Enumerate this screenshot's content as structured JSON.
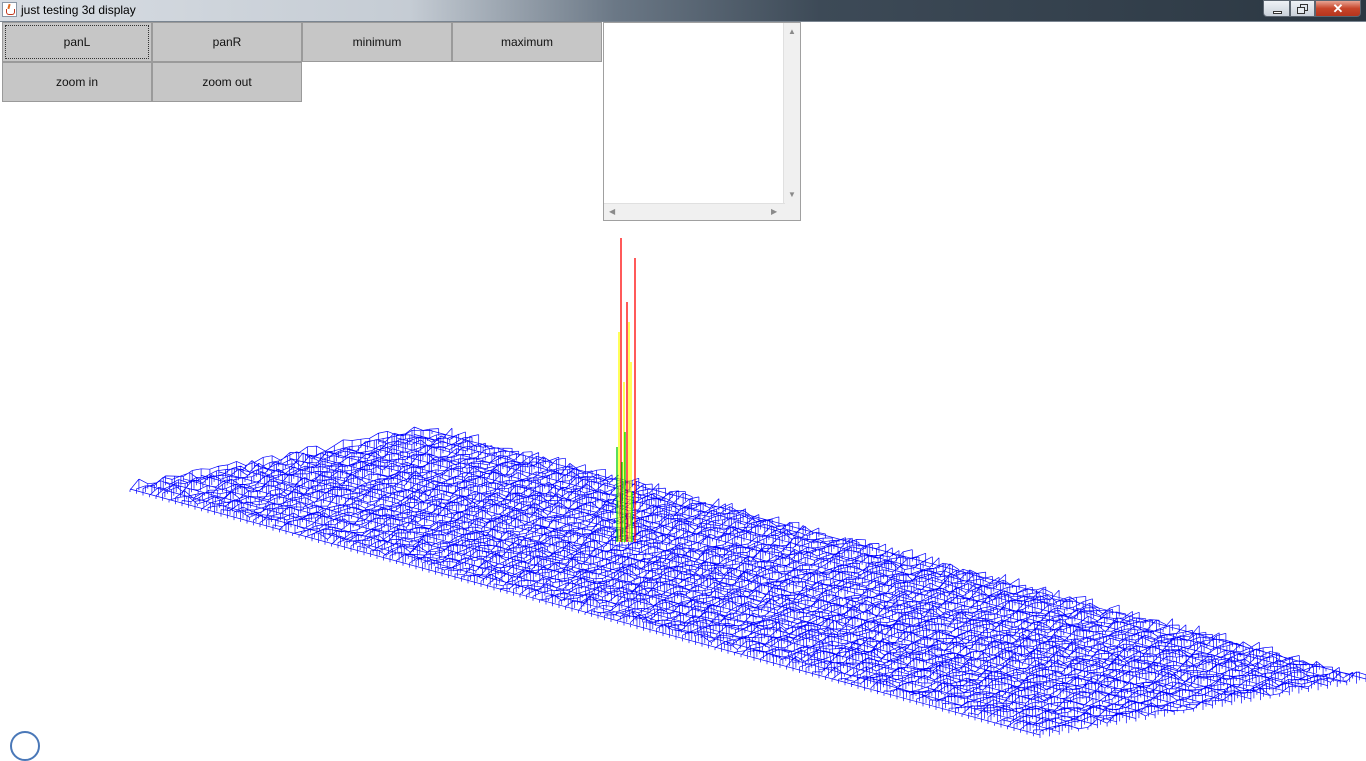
{
  "window": {
    "title": "just testing 3d display",
    "controls": {
      "close": "✕"
    }
  },
  "toolbar": {
    "panL": "panL",
    "panR": "panR",
    "minimum": "minimum",
    "maximum": "maximum",
    "zoom_in": "zoom in",
    "zoom_out": "zoom out"
  },
  "scroll_panel": {
    "up_arrow": "▲",
    "down_arrow": "▼",
    "left_arrow": "◀",
    "right_arrow": "▶"
  },
  "plot": {
    "surface_color": "#0000ff",
    "peak_colors": [
      "#ff0000",
      "#ffff00",
      "#00cc00"
    ],
    "background": "#ffffff"
  }
}
